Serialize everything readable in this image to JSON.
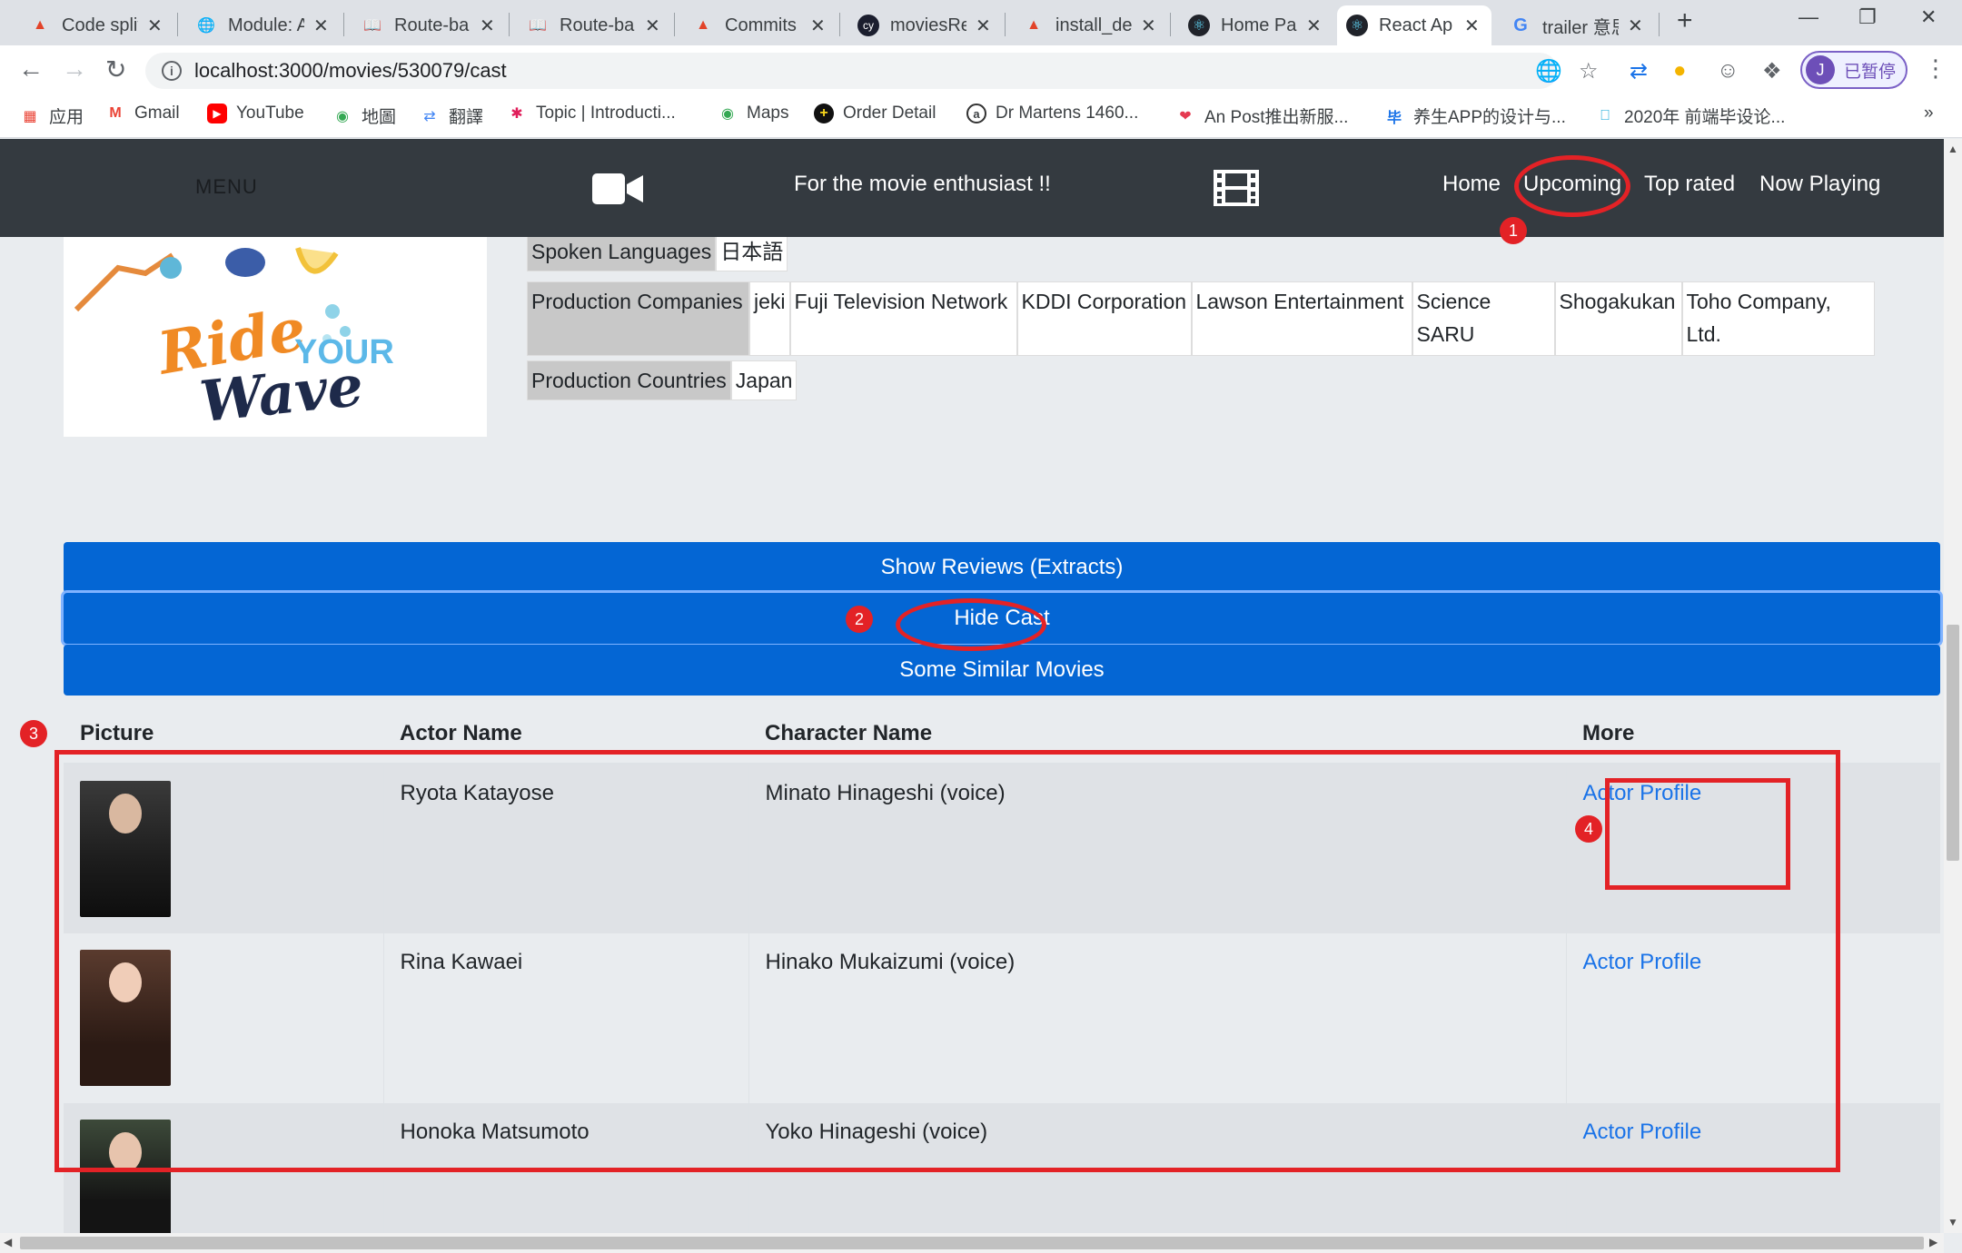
{
  "browser": {
    "tabs": [
      {
        "label": "Code split",
        "icon": "gitlab-icon",
        "color": "#e24329"
      },
      {
        "label": "Module: A",
        "icon": "globe-icon",
        "color": "#5f6368"
      },
      {
        "label": "Route-ba",
        "icon": "book-icon",
        "color": "#3c4043"
      },
      {
        "label": "Route-ba",
        "icon": "book-icon",
        "color": "#3c4043"
      },
      {
        "label": "Commits",
        "icon": "gitlab-icon",
        "color": "#e24329"
      },
      {
        "label": "moviesRe",
        "icon": "cypress-icon",
        "color": "#1b1e2e"
      },
      {
        "label": "install_de",
        "icon": "gitlab-icon",
        "color": "#e24329"
      },
      {
        "label": "Home Pa",
        "icon": "react-icon",
        "color": "#20232a"
      },
      {
        "label": "React Ap",
        "icon": "react-icon",
        "color": "#20232a"
      },
      {
        "label": "trailer 意思",
        "icon": "google-icon",
        "color": "#4285f4"
      }
    ],
    "url": "localhost:3000/movies/530079/cast",
    "profile_label": "已暂停",
    "profile_initial": "J",
    "bookmarks": [
      {
        "label": "应用",
        "icon": "apps-grid-icon"
      },
      {
        "label": "Gmail",
        "icon": "gmail-icon"
      },
      {
        "label": "YouTube",
        "icon": "youtube-icon"
      },
      {
        "label": "地圖",
        "icon": "maps-icon"
      },
      {
        "label": "翻譯",
        "icon": "translate-icon"
      },
      {
        "label": "Topic | Introducti...",
        "icon": "slack-icon"
      },
      {
        "label": "Maps",
        "icon": "maps-icon"
      },
      {
        "label": "Order Detail",
        "icon": "plus-circle-icon"
      },
      {
        "label": "Dr Martens 1460...",
        "icon": "circle-a-icon"
      },
      {
        "label": "An Post推出新服...",
        "icon": "heart-icon"
      },
      {
        "label": "养生APP的设计与...",
        "icon": "bi-icon"
      },
      {
        "label": "2020年 前端毕设论...",
        "icon": "bilibili-icon"
      }
    ]
  },
  "navbar": {
    "menu": "MENU",
    "tagline": "For the movie enthusiast !!",
    "links": [
      "Home",
      "Upcoming",
      "Top rated",
      "Now Playing"
    ]
  },
  "poster": {
    "line1": "Ride",
    "line2": "YOUR",
    "line3": "Wave"
  },
  "details": {
    "spoken_languages_label": "Spoken Languages",
    "spoken_languages_value": "日本語",
    "production_companies_label": "Production Companies",
    "production_companies": [
      "jeki",
      "Fuji Television Network",
      "KDDI Corporation",
      "Lawson Entertainment",
      "Science SARU",
      "Shogakukan",
      "Toho Company, Ltd."
    ],
    "production_countries_label": "Production Countries",
    "production_countries_value": "Japan"
  },
  "actions": {
    "reviews": "Show Reviews (Extracts)",
    "cast": "Hide Cast",
    "similar": "Some Similar Movies"
  },
  "cast_table": {
    "headers": [
      "Picture",
      "Actor Name",
      "Character Name",
      "More"
    ],
    "rows": [
      {
        "actor": "Ryota Katayose",
        "character": "Minato Hinageshi (voice)",
        "more": "Actor Profile"
      },
      {
        "actor": "Rina Kawaei",
        "character": "Hinako Mukaizumi (voice)",
        "more": "Actor Profile"
      },
      {
        "actor": "Honoka Matsumoto",
        "character": "Yoko Hinageshi (voice)",
        "more": "Actor Profile"
      }
    ]
  },
  "annotations": [
    "1",
    "2",
    "3",
    "4"
  ],
  "colors": {
    "navbar": "#343a40",
    "primary_button": "#0466d4",
    "annotation_red": "#e32226",
    "link": "#1a73e8"
  }
}
